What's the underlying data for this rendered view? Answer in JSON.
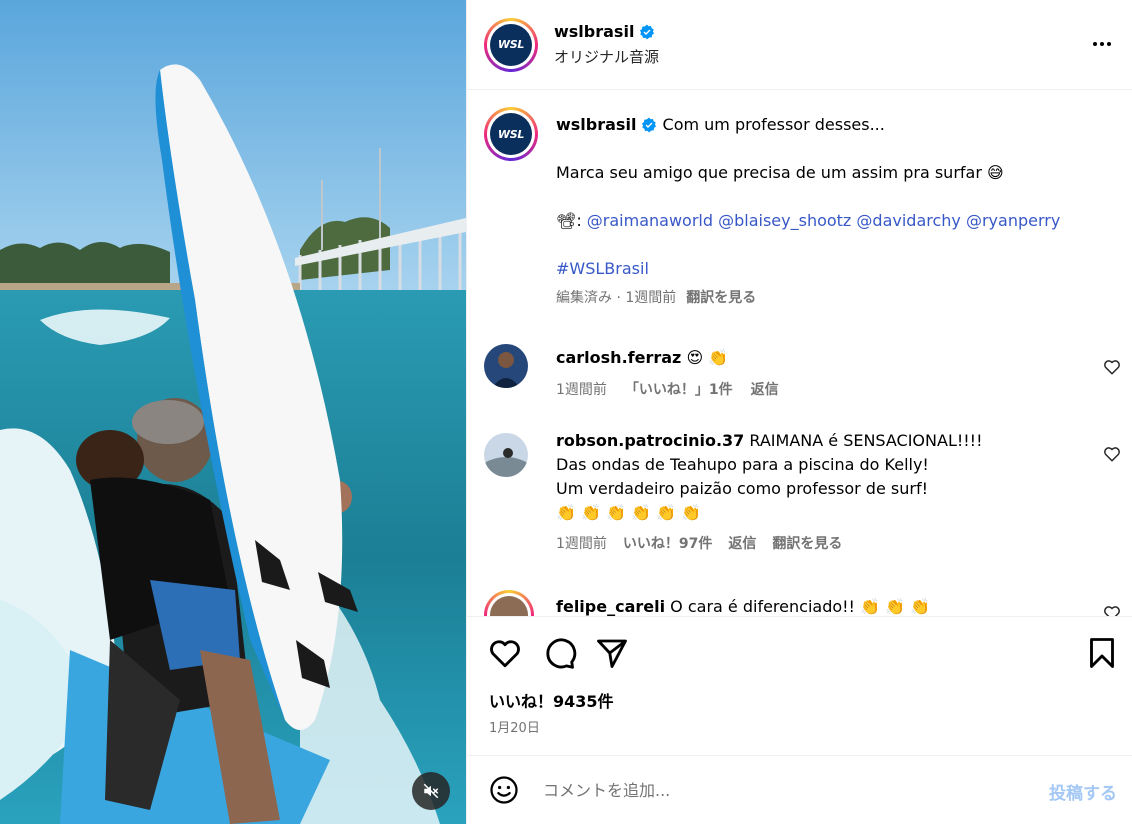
{
  "header": {
    "username": "wslbrasil",
    "audio": "オリジナル音源",
    "avatar_text": "WSL"
  },
  "caption": {
    "username": "wslbrasil",
    "line1": "Com um professor desses...",
    "line2": "Marca seu amigo que precisa de um assim pra surfar 😅",
    "credits_icon": "📽:",
    "mentions": "@raimanaworld @blaisey_shootz @davidarchy @ryanperry",
    "hashtag": "#WSLBrasil",
    "meta_time": "編集済み · 1週間前",
    "meta_translate": "翻訳を見る"
  },
  "comments": [
    {
      "username": "carlosh.ferraz",
      "text": "😍 👏",
      "time": "1週間前",
      "likes": "「いいね！」1件",
      "reply": "返信"
    },
    {
      "username": "robson.patrocinio.37",
      "text_line1": "RAIMANA é SENSACIONAL!!!!",
      "text_line2": "Das ondas de Teahupo para a piscina do Kelly!",
      "text_line3": "Um verdadeiro paizão como professor de surf!",
      "text_line4": "👏 👏 👏 👏 👏 👏",
      "time": "1週間前",
      "likes": "いいね！97件",
      "reply": "返信",
      "translate": "翻訳を見る"
    },
    {
      "username": "felipe_careli",
      "text": "O cara é diferenciado!! 👏 👏 👏"
    }
  ],
  "footer": {
    "likes": "いいね！9435件",
    "date": "1月20日",
    "comment_placeholder": "コメントを追加...",
    "post_label": "投稿する"
  },
  "icons": {
    "mute": "volume-off-icon",
    "like": "heart-icon",
    "comment": "comment-bubble-icon",
    "share": "paper-plane-icon",
    "save": "bookmark-icon",
    "more": "more-horizontal-icon",
    "emoji": "smiley-icon",
    "verified": "verified-badge-icon"
  },
  "colors": {
    "link": "#3858c8",
    "muted": "#737373",
    "verified": "#0095f6",
    "post_button": "#a4c8f5"
  }
}
